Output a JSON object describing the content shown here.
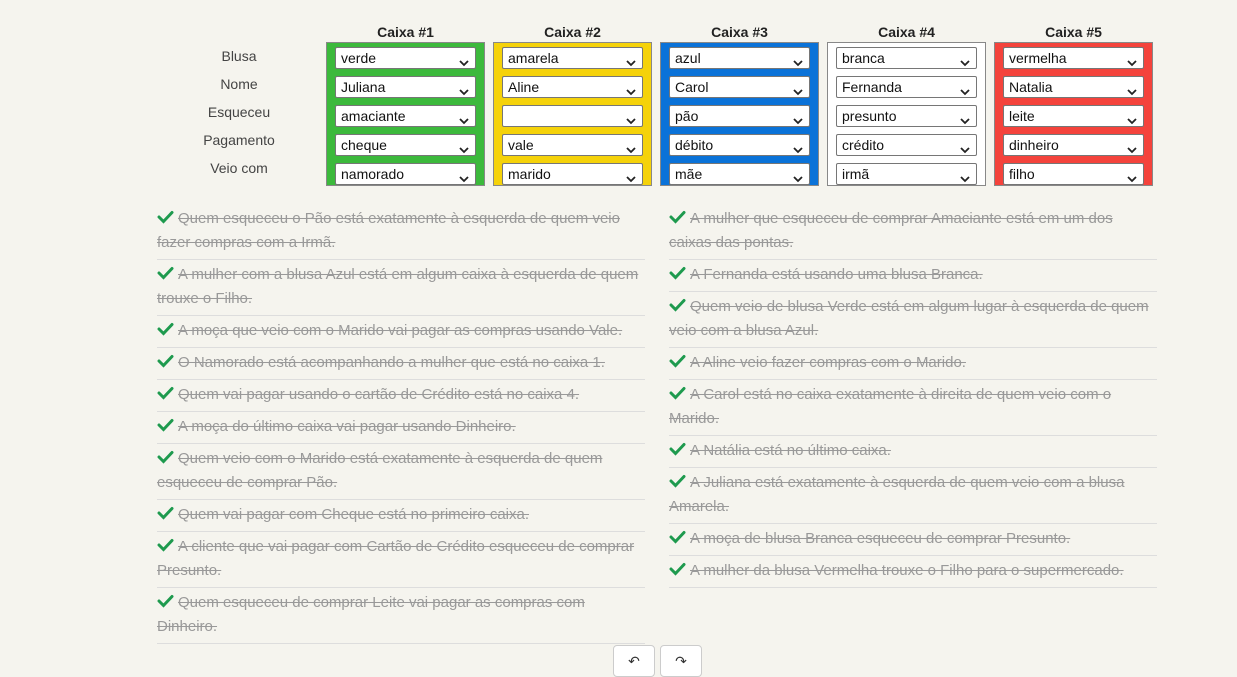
{
  "row_labels": [
    "Blusa",
    "Nome",
    "Esqueceu",
    "Pagamento",
    "Veio com"
  ],
  "boxes": [
    {
      "title": "Caixa #1",
      "color": "#3cb93c",
      "values": [
        "verde",
        "Juliana",
        "amaciante",
        "cheque",
        "namorado"
      ]
    },
    {
      "title": "Caixa #2",
      "color": "#f5d20a",
      "values": [
        "amarela",
        "Aline",
        "",
        "vale",
        "marido"
      ]
    },
    {
      "title": "Caixa #3",
      "color": "#0a72d8",
      "values": [
        "azul",
        "Carol",
        "pão",
        "débito",
        "mãe"
      ]
    },
    {
      "title": "Caixa #4",
      "color": "#ffffff",
      "values": [
        "branca",
        "Fernanda",
        "presunto",
        "crédito",
        "irmã"
      ]
    },
    {
      "title": "Caixa #5",
      "color": "#f4433c",
      "values": [
        "vermelha",
        "Natalia",
        "leite",
        "dinheiro",
        "filho"
      ]
    }
  ],
  "clues_left": [
    "Quem esqueceu o Pão está exatamente à esquerda de quem veio fazer compras com a Irmã.",
    "A mulher com a blusa Azul está em algum caixa à esquerda de quem trouxe o Filho.",
    "A moça que veio com o Marido vai pagar as compras usando Vale.",
    "O Namorado está acompanhando a mulher que está no caixa 1.",
    "Quem vai pagar usando o cartão de Crédito está no caixa 4.",
    "A moça do último caixa vai pagar usando Dinheiro.",
    "Quem veio com o Marido está exatamente à esquerda de quem esqueceu de comprar Pão.",
    "Quem vai pagar com Cheque está no primeiro caixa.",
    "A cliente que vai pagar com Cartão de Crédito esqueceu de comprar Presunto.",
    "Quem esqueceu de comprar Leite vai pagar as compras com Dinheiro."
  ],
  "clues_right": [
    "A mulher que esqueceu de comprar Amaciante está em um dos caixas das pontas.",
    "A Fernanda está usando uma blusa Branca.",
    "Quem veio de blusa Verde está em algum lugar à esquerda de quem veio com a blusa Azul.",
    "A Aline veio fazer compras com o Marido.",
    "A Carol está no caixa exatamente à direita de quem veio com o Marido.",
    "A Natália está no último caixa.",
    "A Juliana está exatamente à esquerda de quem veio com a blusa Amarela.",
    "A moça de blusa Branca esqueceu de comprar Presunto.",
    "A mulher da blusa Vermelha trouxe o Filho para o supermercado."
  ],
  "check_color": "#1e9a4e",
  "buttons": {
    "undo_icon": "undo-icon",
    "redo_icon": "redo-icon"
  }
}
